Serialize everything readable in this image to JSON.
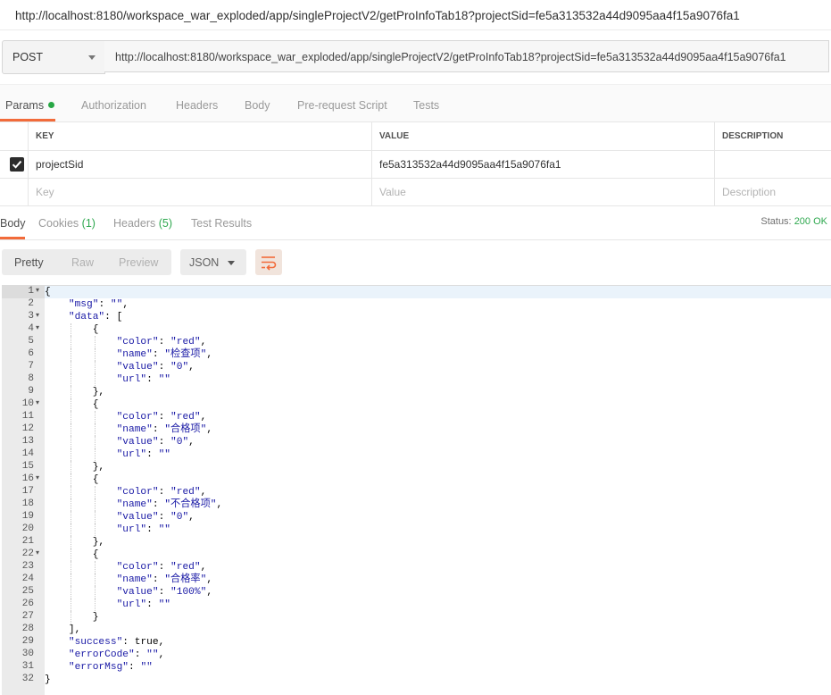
{
  "page": {
    "title_url": "http://localhost:8180/workspace_war_exploded/app/singleProjectV2/getProInfoTab18?projectSid=fe5a313532a44d9095aa4f15a9076fa1"
  },
  "request": {
    "method": "POST",
    "url": "http://localhost:8180/workspace_war_exploded/app/singleProjectV2/getProInfoTab18?projectSid=fe5a313532a44d9095aa4f15a9076fa1"
  },
  "request_tabs": [
    "Params",
    "Authorization",
    "Headers",
    "Body",
    "Pre-request Script",
    "Tests"
  ],
  "params": {
    "headers": {
      "key": "KEY",
      "value": "VALUE",
      "description": "DESCRIPTION"
    },
    "rows": [
      {
        "checked": true,
        "key": "projectSid",
        "value": "fe5a313532a44d9095aa4f15a9076fa1",
        "description": ""
      }
    ],
    "placeholder": {
      "key": "Key",
      "value": "Value",
      "description": "Description"
    }
  },
  "response_tabs": {
    "body": "Body",
    "cookies": "Cookies",
    "cookies_count": "(1)",
    "headers": "Headers",
    "headers_count": "(5)",
    "test_results": "Test Results"
  },
  "status": {
    "label": "Status:",
    "value": "200 OK"
  },
  "view": {
    "pretty": "Pretty",
    "raw": "Raw",
    "preview": "Preview",
    "format": "JSON"
  },
  "colors": {
    "accent": "#f26b3a",
    "ok_green": "#2fa84f",
    "json_string": "#1a1aa6"
  },
  "icons": {
    "wrap": "wrap-lines-icon",
    "dropdown": "chevron-down-icon",
    "check": "checkmark-icon",
    "fold": "fold-arrow-icon"
  },
  "code_lines": [
    {
      "n": "1",
      "fold": true,
      "indent": 0,
      "t": [
        [
          "b",
          "{"
        ]
      ]
    },
    {
      "n": "2",
      "fold": false,
      "indent": 1,
      "t": [
        [
          "s",
          "\"msg\""
        ],
        [
          "k",
          ": "
        ],
        [
          "s",
          "\"\""
        ],
        [
          "k",
          ","
        ]
      ]
    },
    {
      "n": "3",
      "fold": true,
      "indent": 1,
      "t": [
        [
          "s",
          "\"data\""
        ],
        [
          "k",
          ": ["
        ]
      ]
    },
    {
      "n": "4",
      "fold": true,
      "indent": 2,
      "t": [
        [
          "b",
          "{"
        ]
      ]
    },
    {
      "n": "5",
      "fold": false,
      "indent": 3,
      "t": [
        [
          "s",
          "\"color\""
        ],
        [
          "k",
          ": "
        ],
        [
          "s",
          "\"red\""
        ],
        [
          "k",
          ","
        ]
      ]
    },
    {
      "n": "6",
      "fold": false,
      "indent": 3,
      "t": [
        [
          "s",
          "\"name\""
        ],
        [
          "k",
          ": "
        ],
        [
          "s",
          "\"检查项\""
        ],
        [
          "k",
          ","
        ]
      ]
    },
    {
      "n": "7",
      "fold": false,
      "indent": 3,
      "t": [
        [
          "s",
          "\"value\""
        ],
        [
          "k",
          ": "
        ],
        [
          "s",
          "\"0\""
        ],
        [
          "k",
          ","
        ]
      ]
    },
    {
      "n": "8",
      "fold": false,
      "indent": 3,
      "t": [
        [
          "s",
          "\"url\""
        ],
        [
          "k",
          ": "
        ],
        [
          "s",
          "\"\""
        ]
      ]
    },
    {
      "n": "9",
      "fold": false,
      "indent": 2,
      "t": [
        [
          "b",
          "},"
        ]
      ]
    },
    {
      "n": "10",
      "fold": true,
      "indent": 2,
      "t": [
        [
          "b",
          "{"
        ]
      ]
    },
    {
      "n": "11",
      "fold": false,
      "indent": 3,
      "t": [
        [
          "s",
          "\"color\""
        ],
        [
          "k",
          ": "
        ],
        [
          "s",
          "\"red\""
        ],
        [
          "k",
          ","
        ]
      ]
    },
    {
      "n": "12",
      "fold": false,
      "indent": 3,
      "t": [
        [
          "s",
          "\"name\""
        ],
        [
          "k",
          ": "
        ],
        [
          "s",
          "\"合格项\""
        ],
        [
          "k",
          ","
        ]
      ]
    },
    {
      "n": "13",
      "fold": false,
      "indent": 3,
      "t": [
        [
          "s",
          "\"value\""
        ],
        [
          "k",
          ": "
        ],
        [
          "s",
          "\"0\""
        ],
        [
          "k",
          ","
        ]
      ]
    },
    {
      "n": "14",
      "fold": false,
      "indent": 3,
      "t": [
        [
          "s",
          "\"url\""
        ],
        [
          "k",
          ": "
        ],
        [
          "s",
          "\"\""
        ]
      ]
    },
    {
      "n": "15",
      "fold": false,
      "indent": 2,
      "t": [
        [
          "b",
          "},"
        ]
      ]
    },
    {
      "n": "16",
      "fold": true,
      "indent": 2,
      "t": [
        [
          "b",
          "{"
        ]
      ]
    },
    {
      "n": "17",
      "fold": false,
      "indent": 3,
      "t": [
        [
          "s",
          "\"color\""
        ],
        [
          "k",
          ": "
        ],
        [
          "s",
          "\"red\""
        ],
        [
          "k",
          ","
        ]
      ]
    },
    {
      "n": "18",
      "fold": false,
      "indent": 3,
      "t": [
        [
          "s",
          "\"name\""
        ],
        [
          "k",
          ": "
        ],
        [
          "s",
          "\"不合格项\""
        ],
        [
          "k",
          ","
        ]
      ]
    },
    {
      "n": "19",
      "fold": false,
      "indent": 3,
      "t": [
        [
          "s",
          "\"value\""
        ],
        [
          "k",
          ": "
        ],
        [
          "s",
          "\"0\""
        ],
        [
          "k",
          ","
        ]
      ]
    },
    {
      "n": "20",
      "fold": false,
      "indent": 3,
      "t": [
        [
          "s",
          "\"url\""
        ],
        [
          "k",
          ": "
        ],
        [
          "s",
          "\"\""
        ]
      ]
    },
    {
      "n": "21",
      "fold": false,
      "indent": 2,
      "t": [
        [
          "b",
          "},"
        ]
      ]
    },
    {
      "n": "22",
      "fold": true,
      "indent": 2,
      "t": [
        [
          "b",
          "{"
        ]
      ]
    },
    {
      "n": "23",
      "fold": false,
      "indent": 3,
      "t": [
        [
          "s",
          "\"color\""
        ],
        [
          "k",
          ": "
        ],
        [
          "s",
          "\"red\""
        ],
        [
          "k",
          ","
        ]
      ]
    },
    {
      "n": "24",
      "fold": false,
      "indent": 3,
      "t": [
        [
          "s",
          "\"name\""
        ],
        [
          "k",
          ": "
        ],
        [
          "s",
          "\"合格率\""
        ],
        [
          "k",
          ","
        ]
      ]
    },
    {
      "n": "25",
      "fold": false,
      "indent": 3,
      "t": [
        [
          "s",
          "\"value\""
        ],
        [
          "k",
          ": "
        ],
        [
          "s",
          "\"100%\""
        ],
        [
          "k",
          ","
        ]
      ]
    },
    {
      "n": "26",
      "fold": false,
      "indent": 3,
      "t": [
        [
          "s",
          "\"url\""
        ],
        [
          "k",
          ": "
        ],
        [
          "s",
          "\"\""
        ]
      ]
    },
    {
      "n": "27",
      "fold": false,
      "indent": 2,
      "t": [
        [
          "b",
          "}"
        ]
      ]
    },
    {
      "n": "28",
      "fold": false,
      "indent": 1,
      "t": [
        [
          "b",
          "],"
        ]
      ]
    },
    {
      "n": "29",
      "fold": false,
      "indent": 1,
      "t": [
        [
          "s",
          "\"success\""
        ],
        [
          "k",
          ": true,"
        ]
      ]
    },
    {
      "n": "30",
      "fold": false,
      "indent": 1,
      "t": [
        [
          "s",
          "\"errorCode\""
        ],
        [
          "k",
          ": "
        ],
        [
          "s",
          "\"\""
        ],
        [
          "k",
          ","
        ]
      ]
    },
    {
      "n": "31",
      "fold": false,
      "indent": 1,
      "t": [
        [
          "s",
          "\"errorMsg\""
        ],
        [
          "k",
          ": "
        ],
        [
          "s",
          "\"\""
        ]
      ]
    },
    {
      "n": "32",
      "fold": false,
      "indent": 0,
      "t": [
        [
          "b",
          "}"
        ]
      ]
    }
  ]
}
